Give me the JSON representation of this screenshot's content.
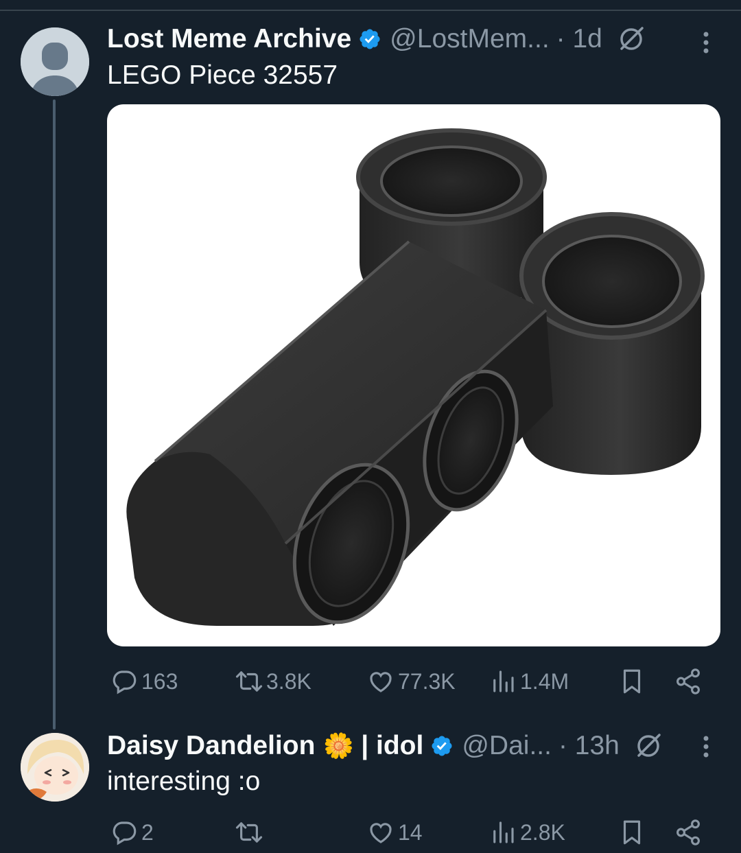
{
  "tweet": {
    "author_name": "Lost Meme Archive",
    "handle": "@LostMem...",
    "time": "· 1d",
    "text": "LEGO Piece 32557",
    "stats": {
      "replies": "163",
      "retweets": "3.8K",
      "likes": "77.3K",
      "views": "1.4M"
    }
  },
  "reply": {
    "author_name": "Daisy Dandelion",
    "name_emoji": "🌼",
    "name_suffix": "| idol",
    "handle": "@Dai...",
    "time": "· 13h",
    "text": "interesting :o",
    "stats": {
      "replies": "2",
      "retweets": "",
      "likes": "14",
      "views": "2.8K"
    }
  },
  "colors": {
    "background": "#15202b",
    "verified_badge": "#1d9bf0",
    "muted_text": "#8b98a5",
    "thread_line": "#4a5d6e"
  },
  "icons": [
    "verified-badge-icon",
    "grok-icon",
    "more-icon",
    "reply-icon",
    "retweet-icon",
    "like-icon",
    "views-icon",
    "bookmark-icon",
    "share-icon"
  ]
}
